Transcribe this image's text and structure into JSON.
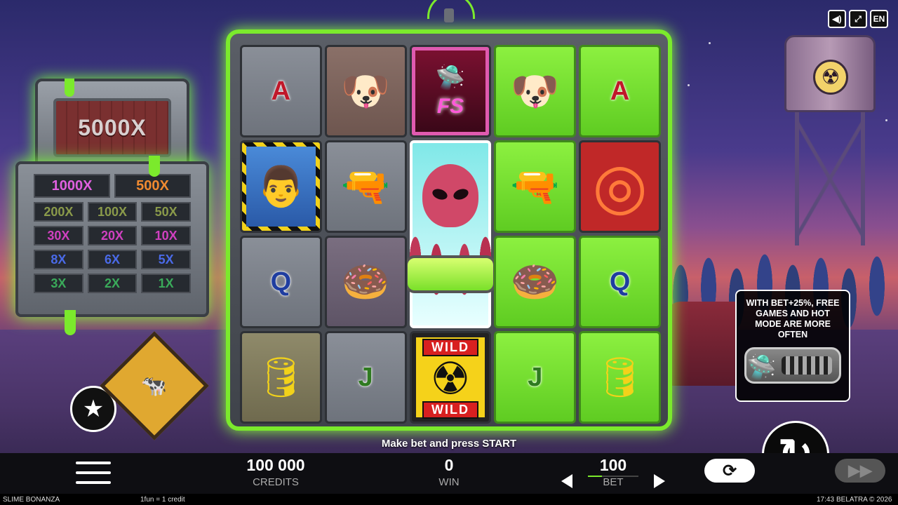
{
  "game": {
    "title": "SLIME BONANZA",
    "credit_note": "1fun = 1 credit",
    "time": "17:43",
    "brand": "BELATRA © 2026"
  },
  "top_controls": {
    "sound_icon": "speaker-icon",
    "fullscreen_icon": "fullscreen-icon",
    "language": "EN"
  },
  "paytable": {
    "jackpot": "5000X",
    "tier1": [
      "1000X",
      "500X"
    ],
    "tiers": [
      [
        "200X",
        "100X",
        "50X"
      ],
      [
        "30X",
        "20X",
        "10X"
      ],
      [
        "8X",
        "6X",
        "5X"
      ],
      [
        "3X",
        "2X",
        "1X"
      ]
    ],
    "colors": {
      "1000X": "#c040c0",
      "500X": "#e07a20",
      "row0": "#7a8a3a",
      "row1": "#c030b0",
      "row2": "#3a5ad8",
      "row3": "#2a9a4a"
    }
  },
  "reels": [
    [
      "A",
      "pug",
      "FS",
      "pug",
      "A"
    ],
    [
      "miner",
      "raygun",
      "alien",
      "raygun",
      "shutter"
    ],
    [
      "Q",
      "donut",
      "alien",
      "donut",
      "Q"
    ],
    [
      "barrel",
      "J",
      "WILD",
      "J",
      "barrel"
    ]
  ],
  "wild": {
    "top": "WILD",
    "bottom": "WILD"
  },
  "fs_label": "FS",
  "promo": {
    "text": "WITH BET+25%, FREE GAMES AND HOT MODE ARE MORE OFTEN"
  },
  "status_message": "Make bet and press START",
  "bottom": {
    "credits_value": "100 000",
    "credits_label": "CREDITS",
    "win_value": "0",
    "win_label": "WIN",
    "bet_value": "100",
    "bet_label": "BET"
  },
  "icons": {
    "star": "★",
    "spin": "↻",
    "auto": "⟳",
    "turbo": "▶▶",
    "ufo": "🛸",
    "pug": "🐶",
    "donut": "🍩",
    "barrel": "🛢",
    "raygun": "🔫",
    "miner": "👨",
    "shutter": "◎",
    "radiation": "☢",
    "cow": "🐄"
  }
}
